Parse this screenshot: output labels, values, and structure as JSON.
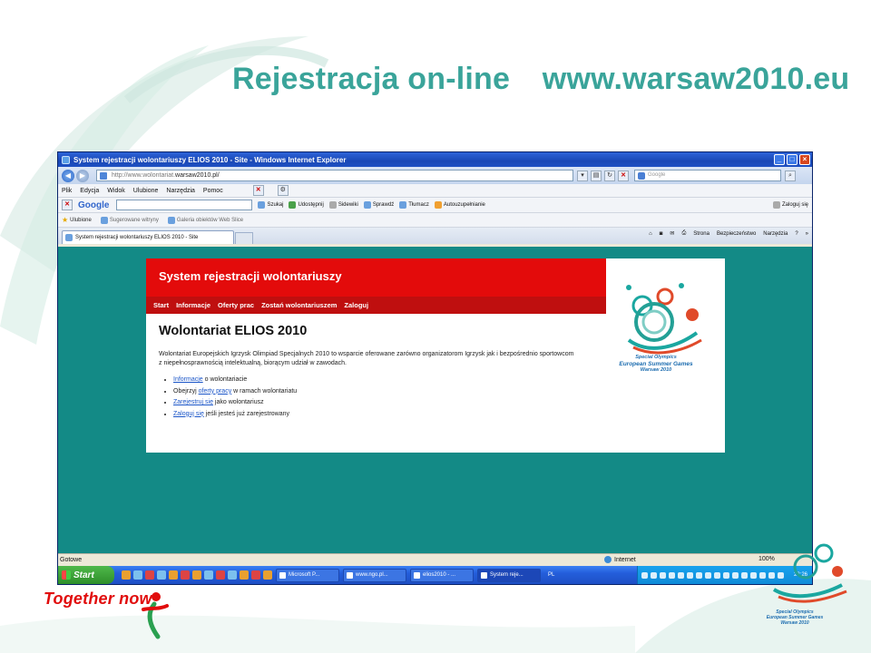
{
  "slide": {
    "title_left": "Rejestracja on-line",
    "title_right": "www.warsaw2010.eu",
    "bottom_slogan": "Together now",
    "corner_logo_lines": [
      "Special Olympics",
      "European Summer Games",
      "Warsaw 2010"
    ]
  },
  "browser": {
    "window_title": "System rejestracji wolontariuszy ELIOS 2010 - Site - Windows Internet Explorer",
    "address_prefix": "http://www.wolontariat.",
    "address_host": "warsaw2010.pl/",
    "search_placeholder": "Google",
    "menu": [
      "Plik",
      "Edycja",
      "Widok",
      "Ulubione",
      "Narzędzia",
      "Pomoc"
    ],
    "google_toolbar": {
      "logo": "Google",
      "items": [
        "Szukaj",
        "Udostępnij",
        "Sidewiki",
        "Sprawdź",
        "Tłumacz",
        "Autouzupełnianie"
      ],
      "signin": "Zaloguj się"
    },
    "favorites": {
      "label": "Ulubione",
      "items": [
        "Sugerowane witryny",
        "Galeria obiektów Web Slice"
      ]
    },
    "tab_title": "System rejestracji wolontariuszy ELIOS 2010 - Site",
    "command_bar": [
      "Strona",
      "Bezpieczeństwo",
      "Narzędzia"
    ],
    "status_text": "Gotowe",
    "status_zone": "Internet",
    "zoom": "100%"
  },
  "site": {
    "header": "System rejestracji wolontariuszy",
    "nav": [
      "Start",
      "Informacje",
      "Oferty prac",
      "Zostań wolontariuszem",
      "Zaloguj"
    ],
    "heading": "Wolontariat ELIOS 2010",
    "description": "Wolontariat Europejskich Igrzysk Olimpiad Specjalnych 2010 to wsparcie oferowane zarówno organizatorom Igrzysk jak i bezpośrednio sportowcom z niepełnosprawnością intelektualną, biorącym udział w zawodach.",
    "list": [
      {
        "link": "Informacje",
        "rest": " o wolontariacie",
        "prefix": ""
      },
      {
        "link": "oferty pracy",
        "rest": " w ramach wolontariatu",
        "prefix": "Obejrzyj "
      },
      {
        "link": "Zarejestruj się",
        "rest": " jako wolontariusz",
        "prefix": ""
      },
      {
        "link": "Zaloguj się",
        "rest": " jeśli jesteś już zarejestrowany",
        "prefix": ""
      }
    ],
    "logo_lines": [
      "Special Olympics",
      "European Summer Games",
      "Warsaw 2010"
    ]
  },
  "taskbar": {
    "start": "Start",
    "tasks": [
      "Microsoft P...",
      "www.ngo.pl...",
      "elios2010 - ...",
      "System reje..."
    ],
    "lang": "PL",
    "time": "23:26"
  },
  "colors": {
    "title_teal": "#3aa49a",
    "site_red": "#e30b0b",
    "viewport_teal": "#138a86",
    "slogan_red": "#e10d0d"
  }
}
